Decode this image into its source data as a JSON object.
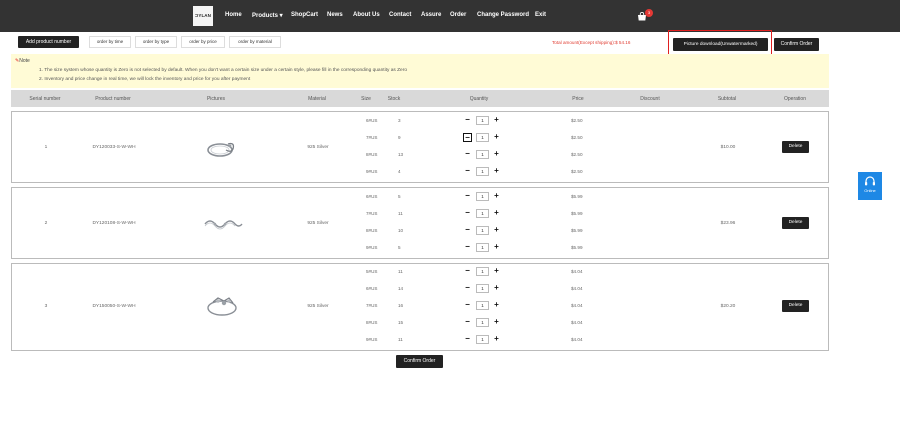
{
  "header": {
    "logo_text": "ƆYLAN",
    "nav": [
      {
        "label": "Home"
      },
      {
        "label": "Products ▾"
      },
      {
        "label": "ShopCart"
      },
      {
        "label": "News"
      },
      {
        "label": "About Us"
      },
      {
        "label": "Contact"
      },
      {
        "label": "Assure"
      },
      {
        "label": "Order"
      },
      {
        "label": "Change Password"
      },
      {
        "label": "Exit"
      }
    ],
    "cart_count": "3"
  },
  "toolbar": {
    "add_product": "Add product number",
    "sort": [
      "order by time",
      "order by type",
      "order by price",
      "order by material"
    ],
    "total_label": "Total amount(Except shipping):$",
    "total_value": "54.16",
    "picture_download": "Picture download(Unwatermarked)",
    "confirm_order": "Confirm Order"
  },
  "note": {
    "title": "Note",
    "line1": "1. The size system whose quantity is Zero is not selected by default. When you don't want a certain size under a certain style, please fill in the corresponding quantity as Zero",
    "line2": "2. Inventory and price change in real time, we will lock the inventory and price for you after payment"
  },
  "table": {
    "headers": [
      "Serial number",
      "Product number",
      "Pictures",
      "Material",
      "Size",
      "Stock",
      "Quantity",
      "Price",
      "Discount",
      "Subtotal",
      "Operation"
    ]
  },
  "products": [
    {
      "serial": "1",
      "number": "DY120033-S-W-WH",
      "material": "925 Silver",
      "subtotal": "$10.00",
      "delete": "Delete",
      "sizes": [
        {
          "size": "6#US",
          "stock": "3",
          "qty": "1",
          "price": "$2.50"
        },
        {
          "size": "7#US",
          "stock": "9",
          "qty": "1",
          "price": "$2.50"
        },
        {
          "size": "8#US",
          "stock": "13",
          "qty": "1",
          "price": "$2.50"
        },
        {
          "size": "9#US",
          "stock": "4",
          "qty": "1",
          "price": "$2.50"
        }
      ]
    },
    {
      "serial": "2",
      "number": "DY120108-S-W-WH",
      "material": "925 Silver",
      "subtotal": "$23.96",
      "delete": "Delete",
      "sizes": [
        {
          "size": "6#US",
          "stock": "5",
          "qty": "1",
          "price": "$5.99"
        },
        {
          "size": "7#US",
          "stock": "11",
          "qty": "1",
          "price": "$5.99"
        },
        {
          "size": "8#US",
          "stock": "10",
          "qty": "1",
          "price": "$5.99"
        },
        {
          "size": "9#US",
          "stock": "5",
          "qty": "1",
          "price": "$5.99"
        }
      ]
    },
    {
      "serial": "3",
      "number": "DY150050-S-W-WH",
      "material": "925 Silver",
      "subtotal": "$20.20",
      "delete": "Delete",
      "sizes": [
        {
          "size": "5#US",
          "stock": "11",
          "qty": "1",
          "price": "$4.04"
        },
        {
          "size": "6#US",
          "stock": "14",
          "qty": "1",
          "price": "$4.04"
        },
        {
          "size": "7#US",
          "stock": "16",
          "qty": "1",
          "price": "$4.04"
        },
        {
          "size": "8#US",
          "stock": "15",
          "qty": "1",
          "price": "$4.04"
        },
        {
          "size": "9#US",
          "stock": "11",
          "qty": "1",
          "price": "$4.04"
        }
      ]
    }
  ],
  "footer": {
    "confirm_order": "Confirm Order"
  },
  "online": {
    "label": "Online",
    "icon": "headset-icon"
  },
  "colors": {
    "accent_red": "#e03c31",
    "dark": "#222222",
    "header": "#333333",
    "note_bg": "#fffbd6",
    "online_blue": "#1e88e5"
  }
}
